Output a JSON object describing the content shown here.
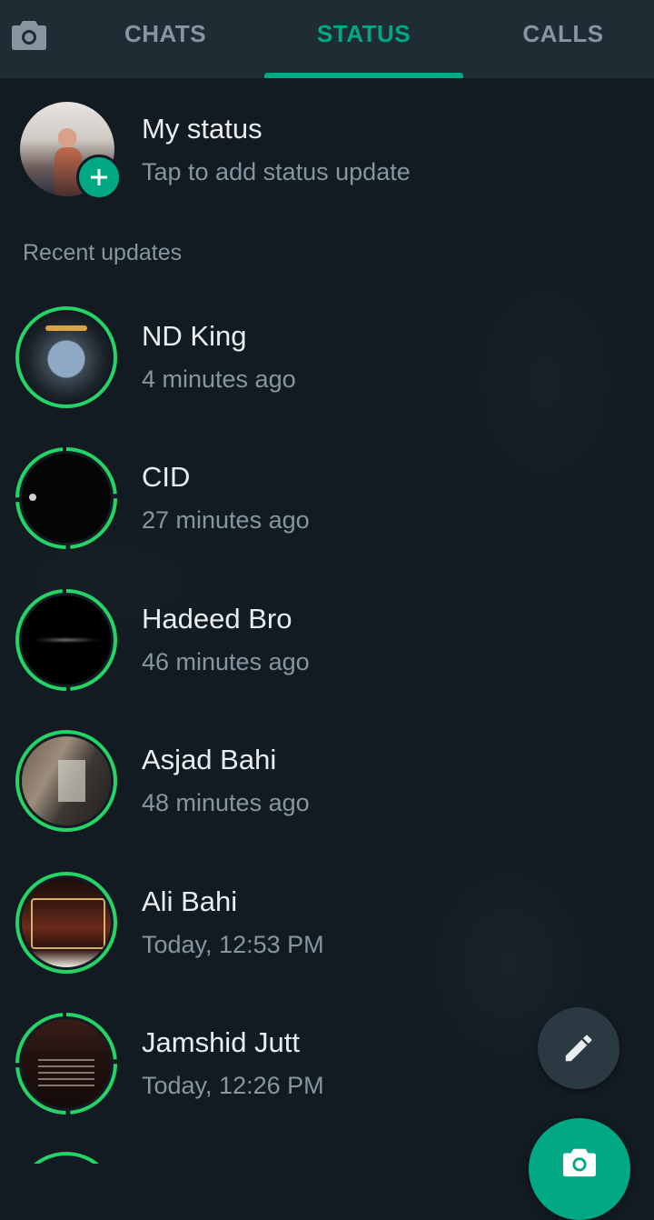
{
  "tabs": [
    {
      "label": "CHATS",
      "active": false
    },
    {
      "label": "STATUS",
      "active": true
    },
    {
      "label": "CALLS",
      "active": false
    }
  ],
  "my_status": {
    "title": "My status",
    "subtitle": "Tap to add status update"
  },
  "recent_updates_label": "Recent updates",
  "statuses": [
    {
      "name": "ND King",
      "time": "4 minutes ago"
    },
    {
      "name": "CID",
      "time": "27 minutes ago"
    },
    {
      "name": "Hadeed Bro",
      "time": "46 minutes ago"
    },
    {
      "name": "Asjad Bahi",
      "time": "48 minutes ago"
    },
    {
      "name": "Ali Bahi",
      "time": "Today, 12:53 PM"
    },
    {
      "name": "Jamshid Jutt",
      "time": "Today, 12:26 PM"
    }
  ],
  "icons": {
    "camera_tab": "camera-icon",
    "add_status": "plus-icon",
    "fab_text": "pencil-icon",
    "fab_camera": "camera-icon"
  },
  "colors": {
    "accent": "#00a884",
    "background": "#121b22",
    "header": "#1f2c34",
    "muted_text": "#8696a0",
    "primary_text": "#e9edef",
    "ring_unseen": "#25d366"
  }
}
